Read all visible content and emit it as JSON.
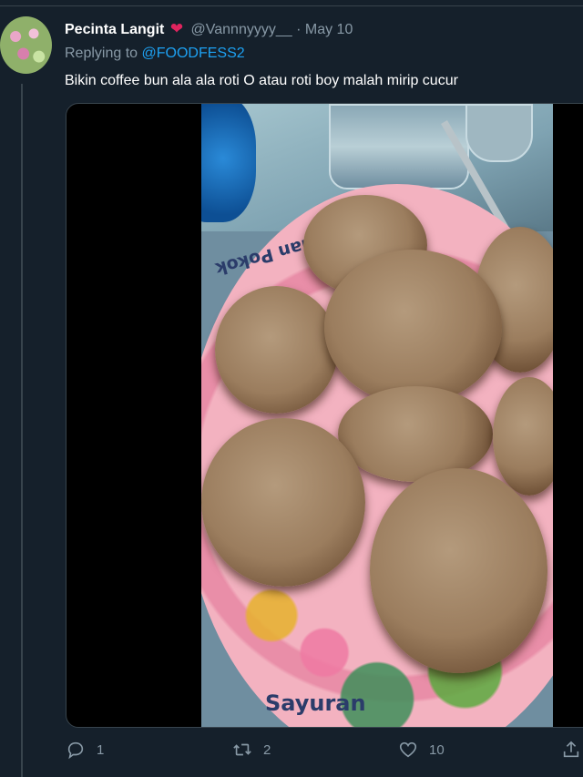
{
  "tweet": {
    "display_name": "Pecinta Langit",
    "handle": "@Vannnyyyy__",
    "separator": "·",
    "date": "May 10",
    "replying_prefix": "Replying to",
    "replying_to": "@FOODFESS2",
    "text": "Bikin coffee bun ala ala roti O atau roti boy malah mirip cucur"
  },
  "media": {
    "plate_text_top": "nan Pokok",
    "plate_text_bottom": "Sayuran"
  },
  "actions": {
    "reply_count": "1",
    "retweet_count": "2",
    "like_count": "10"
  },
  "colors": {
    "background": "#15202b",
    "text_secondary": "#8899a6",
    "link": "#1da1f2",
    "heart": "#e0245e"
  }
}
